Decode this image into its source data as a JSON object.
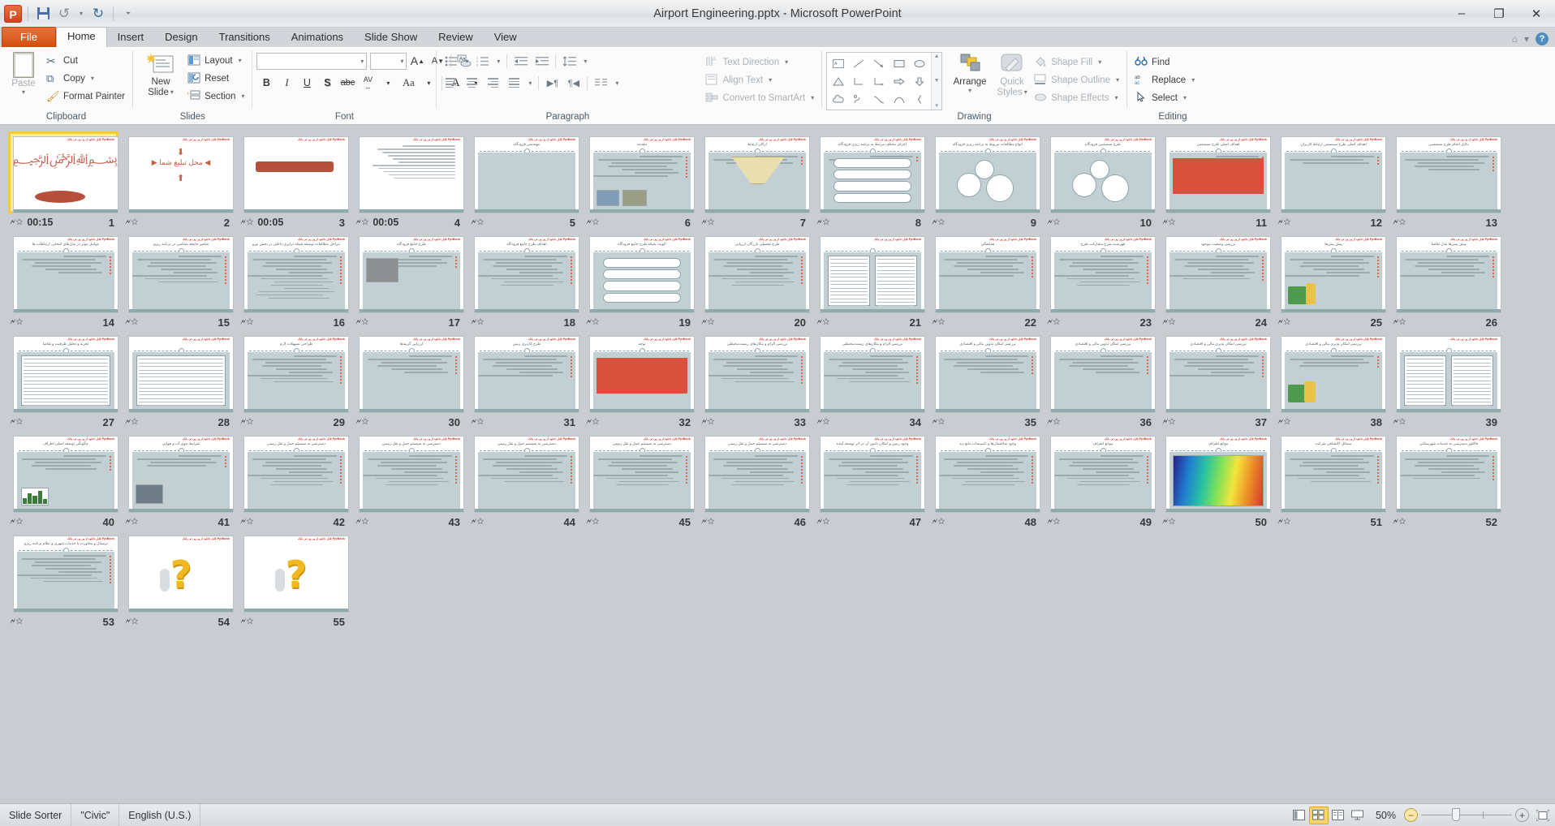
{
  "window": {
    "title": "Airport Engineering.pptx  -  Microsoft PowerPoint",
    "app_icon": "P",
    "minimize": "–",
    "restore": "❐",
    "close": "✕"
  },
  "quick_access": {
    "save": "save-icon",
    "undo": "undo-icon",
    "undo_caret": "▾",
    "redo": "redo-icon",
    "customize": "▾"
  },
  "tabs": [
    {
      "label": "File",
      "state": "file"
    },
    {
      "label": "Home",
      "state": "active"
    },
    {
      "label": "Insert",
      "state": "normal"
    },
    {
      "label": "Design",
      "state": "normal"
    },
    {
      "label": "Transitions",
      "state": "normal"
    },
    {
      "label": "Animations",
      "state": "normal"
    },
    {
      "label": "Slide Show",
      "state": "normal"
    },
    {
      "label": "Review",
      "state": "normal"
    },
    {
      "label": "View",
      "state": "normal"
    }
  ],
  "ribbon": {
    "clipboard": {
      "name": "Clipboard",
      "paste": "Paste",
      "cut": "Cut",
      "copy": "Copy",
      "format_painter": "Format Painter"
    },
    "slides": {
      "name": "Slides",
      "new_slide": "New\nSlide",
      "new_slide_l1": "New",
      "new_slide_l2": "Slide",
      "layout": "Layout",
      "reset": "Reset",
      "section": "Section"
    },
    "font": {
      "name": "Font",
      "font_name_value": "",
      "font_size_value": "",
      "grow": "A",
      "shrink": "A",
      "clear_formatting": "Aa",
      "bold": "B",
      "italic": "I",
      "underline": "U",
      "shadow": "S",
      "strikethrough": "abc",
      "character_spacing": "AV",
      "change_case": "Aa",
      "font_color": "A"
    },
    "paragraph": {
      "name": "Paragraph",
      "text_direction": "Text Direction",
      "align_text": "Align Text",
      "convert_to_smartart": "Convert to SmartArt"
    },
    "drawing": {
      "name": "Drawing",
      "arrange": "Arrange",
      "quick_styles_l1": "Quick",
      "quick_styles_l2": "Styles",
      "shape_fill": "Shape Fill",
      "shape_outline": "Shape Outline",
      "shape_effects": "Shape Effects"
    },
    "editing": {
      "name": "Editing",
      "find": "Find",
      "replace": "Replace",
      "select": "Select"
    }
  },
  "status_bar": {
    "view_name": "Slide Sorter",
    "theme": "\"Civic\"",
    "language": "English (U.S.)",
    "zoom_level": "50%",
    "zoom_out": "−",
    "zoom_in": "+",
    "views": [
      "normal-view",
      "slide-sorter-view",
      "reading-view",
      "slide-show-view"
    ],
    "fit_to_window": "fit-slide-icon"
  },
  "slides": [
    {
      "n": "1",
      "time": "00:15",
      "title": "",
      "kind": "bismillah",
      "lines": 0
    },
    {
      "n": "2",
      "time": "",
      "title": "محل تبلیغ شما",
      "kind": "promo",
      "lines": 0
    },
    {
      "n": "3",
      "time": "00:05",
      "title": "",
      "kind": "banner",
      "lines": 0
    },
    {
      "n": "4",
      "time": "00:05",
      "title": "",
      "kind": "textpage",
      "lines": 9
    },
    {
      "n": "5",
      "time": "",
      "title": "مهندسی فرودگاه",
      "kind": "titleonly",
      "lines": 0
    },
    {
      "n": "6",
      "time": "",
      "title": "مقدمه",
      "kind": "photos",
      "lines": 7
    },
    {
      "n": "7",
      "time": "",
      "title": "ارکان ارتباط",
      "kind": "funnel",
      "lines": 3
    },
    {
      "n": "8",
      "time": "",
      "title": "اجزای مختلف مرتبط به برنامه ریزی فرودگاه",
      "kind": "flow",
      "lines": 2
    },
    {
      "n": "9",
      "time": "",
      "title": "انواع مطالعات مربوط به برنامه ریزی فرودگاه",
      "kind": "gears",
      "lines": 0
    },
    {
      "n": "10",
      "time": "",
      "title": "طرح سیستمی فرودگاه",
      "kind": "gears2",
      "lines": 0
    },
    {
      "n": "11",
      "time": "",
      "title": "اهداف اصلی طرح سیستمی",
      "kind": "redbox",
      "lines": 5
    },
    {
      "n": "12",
      "time": "",
      "title": "اهداف اصلی طرح سیستمی ارتباط کاربران",
      "kind": "text",
      "lines": 3
    },
    {
      "n": "13",
      "time": "",
      "title": "دلایل انجام طرح سیستمی",
      "kind": "text",
      "lines": 5
    },
    {
      "n": "14",
      "time": "",
      "title": "عوامل موثر در مدل‌های انتخابی ارتباطات ها",
      "kind": "text",
      "lines": 6
    },
    {
      "n": "15",
      "time": "",
      "title": "عناصر جامعه شناسی در برنامه ریزی",
      "kind": "text",
      "lines": 9
    },
    {
      "n": "16",
      "time": "",
      "title": "مراحل مطالعات توسعه شبکه ترابری داخلی در بخش نیرو",
      "kind": "text",
      "lines": 14
    },
    {
      "n": "17",
      "time": "",
      "title": "طرح جامع فرودگاه",
      "kind": "photo",
      "lines": 4
    },
    {
      "n": "18",
      "time": "",
      "title": "اهداف طرح جامع فرودگاه",
      "kind": "text",
      "lines": 10
    },
    {
      "n": "19",
      "time": "",
      "title": "الویت شبکه طرح جامع فرودگاه",
      "kind": "flow2",
      "lines": 0
    },
    {
      "n": "20",
      "time": "",
      "title": "طرح تفصیلی بازرگان ارزیابی",
      "kind": "text",
      "lines": 10
    },
    {
      "n": "21",
      "time": "",
      "title": "",
      "kind": "twotables",
      "lines": 0
    },
    {
      "n": "22",
      "time": "",
      "title": "هماهنگی",
      "kind": "text",
      "lines": 7
    },
    {
      "n": "23",
      "time": "",
      "title": "فهرست شرح مشارکت طرح",
      "kind": "text",
      "lines": 10
    },
    {
      "n": "24",
      "time": "",
      "title": "بررسی وضعیت موجود",
      "kind": "text",
      "lines": 8
    },
    {
      "n": "25",
      "time": "",
      "title": "پیش بینی‌ها",
      "kind": "iconchart",
      "lines": 7
    },
    {
      "n": "26",
      "time": "",
      "title": "پیش بینی‌ها     مدل تقاضا",
      "kind": "text",
      "lines": 7
    },
    {
      "n": "27",
      "time": "",
      "title": "تجزیه و تحلیل ظرفیت و تقاضا",
      "kind": "table",
      "lines": 0
    },
    {
      "n": "28",
      "time": "",
      "title": "",
      "kind": "table",
      "lines": 0
    },
    {
      "n": "29",
      "time": "",
      "title": "طراحی تسهیلات لازم",
      "kind": "text",
      "lines": 9
    },
    {
      "n": "30",
      "time": "",
      "title": "ارزیابی گزینه‌ها",
      "kind": "text",
      "lines": 6
    },
    {
      "n": "31",
      "time": "",
      "title": "طرح کاربری زمین",
      "kind": "text",
      "lines": 7
    },
    {
      "n": "32",
      "time": "",
      "title": "توجه",
      "kind": "redbox",
      "lines": 0
    },
    {
      "n": "33",
      "time": "",
      "title": "بررسی الزام و مکان‌های زیست‌محیطی",
      "kind": "text",
      "lines": 9
    },
    {
      "n": "34",
      "time": "",
      "title": "بررسی الزام و مکان‌های زیست‌محیطی",
      "kind": "text",
      "lines": 9
    },
    {
      "n": "35",
      "time": "",
      "title": "بررسی امکان تدوین مالی و اقتصادی",
      "kind": "text",
      "lines": 6
    },
    {
      "n": "36",
      "time": "",
      "title": "بررسی امکان تدوین مالی و اقتصادی",
      "kind": "text",
      "lines": 6
    },
    {
      "n": "37",
      "time": "",
      "title": "بررسی امکان پذیری مالی و اقتصادی",
      "kind": "text",
      "lines": 7
    },
    {
      "n": "38",
      "time": "",
      "title": "بررسی امکان پذیری مالی و اقتصادی",
      "kind": "chartimg",
      "lines": 4
    },
    {
      "n": "39",
      "time": "",
      "title": "",
      "kind": "twotables",
      "lines": 0
    },
    {
      "n": "40",
      "time": "",
      "title": "چگونگی توسعه اصلی اطراف",
      "kind": "minibar",
      "lines": 5
    },
    {
      "n": "41",
      "time": "",
      "title": "شرایط جوی آب و هوایی",
      "kind": "photo2",
      "lines": 4
    },
    {
      "n": "42",
      "time": "",
      "title": "دسترسی به سیستم حمل و نقل زمینی",
      "kind": "text",
      "lines": 10
    },
    {
      "n": "43",
      "time": "",
      "title": "دسترسی به سیستم حمل و نقل زمینی",
      "kind": "text",
      "lines": 10
    },
    {
      "n": "44",
      "time": "",
      "title": "دسترسی به سیستم حمل و نقل زمینی",
      "kind": "text",
      "lines": 9
    },
    {
      "n": "45",
      "time": "",
      "title": "دسترسی به سیستم حمل و نقل زمینی",
      "kind": "text",
      "lines": 10
    },
    {
      "n": "46",
      "time": "",
      "title": "دسترسی به سیستم حمل و نقل زمینی",
      "kind": "text",
      "lines": 10
    },
    {
      "n": "47",
      "time": "",
      "title": "وجود زمین و امکان تامین آن در اثر توسعه آینده",
      "kind": "text",
      "lines": 10
    },
    {
      "n": "48",
      "time": "",
      "title": "وجود ساختمان‌ها و تاسیسات مانع دید",
      "kind": "text",
      "lines": 10
    },
    {
      "n": "49",
      "time": "",
      "title": "موانع اطراف",
      "kind": "text",
      "lines": 10
    },
    {
      "n": "50",
      "time": "",
      "title": "موانع اطراف",
      "kind": "heatmap",
      "lines": 0
    },
    {
      "n": "51",
      "time": "",
      "title": "مسائل اکتشافی شرکت",
      "kind": "text",
      "lines": 9
    },
    {
      "n": "52",
      "time": "",
      "title": "فاکتور دسترسی به خدمات شهرستانی",
      "kind": "text",
      "lines": 8
    },
    {
      "n": "53",
      "time": "",
      "title": "ترمینال و مجاورت با خدمات شهری و نظام برنامه ریزی",
      "kind": "text",
      "lines": 9
    },
    {
      "n": "54",
      "time": "",
      "title": "",
      "kind": "questionmark",
      "lines": 0
    },
    {
      "n": "55",
      "time": "",
      "title": "",
      "kind": "questionmark",
      "lines": 0
    }
  ],
  "slide_watermark": "قابل دانلود از پی پی تی بانک PptBank",
  "colors": {
    "accent_orange": "#d2500f",
    "selection_gold": "#f5c842",
    "slide_body": "#c3d0d3",
    "slide_foot": "#8fa9ad",
    "title_text": "#4b5a62",
    "watermark_red": "#cf3a2e"
  }
}
